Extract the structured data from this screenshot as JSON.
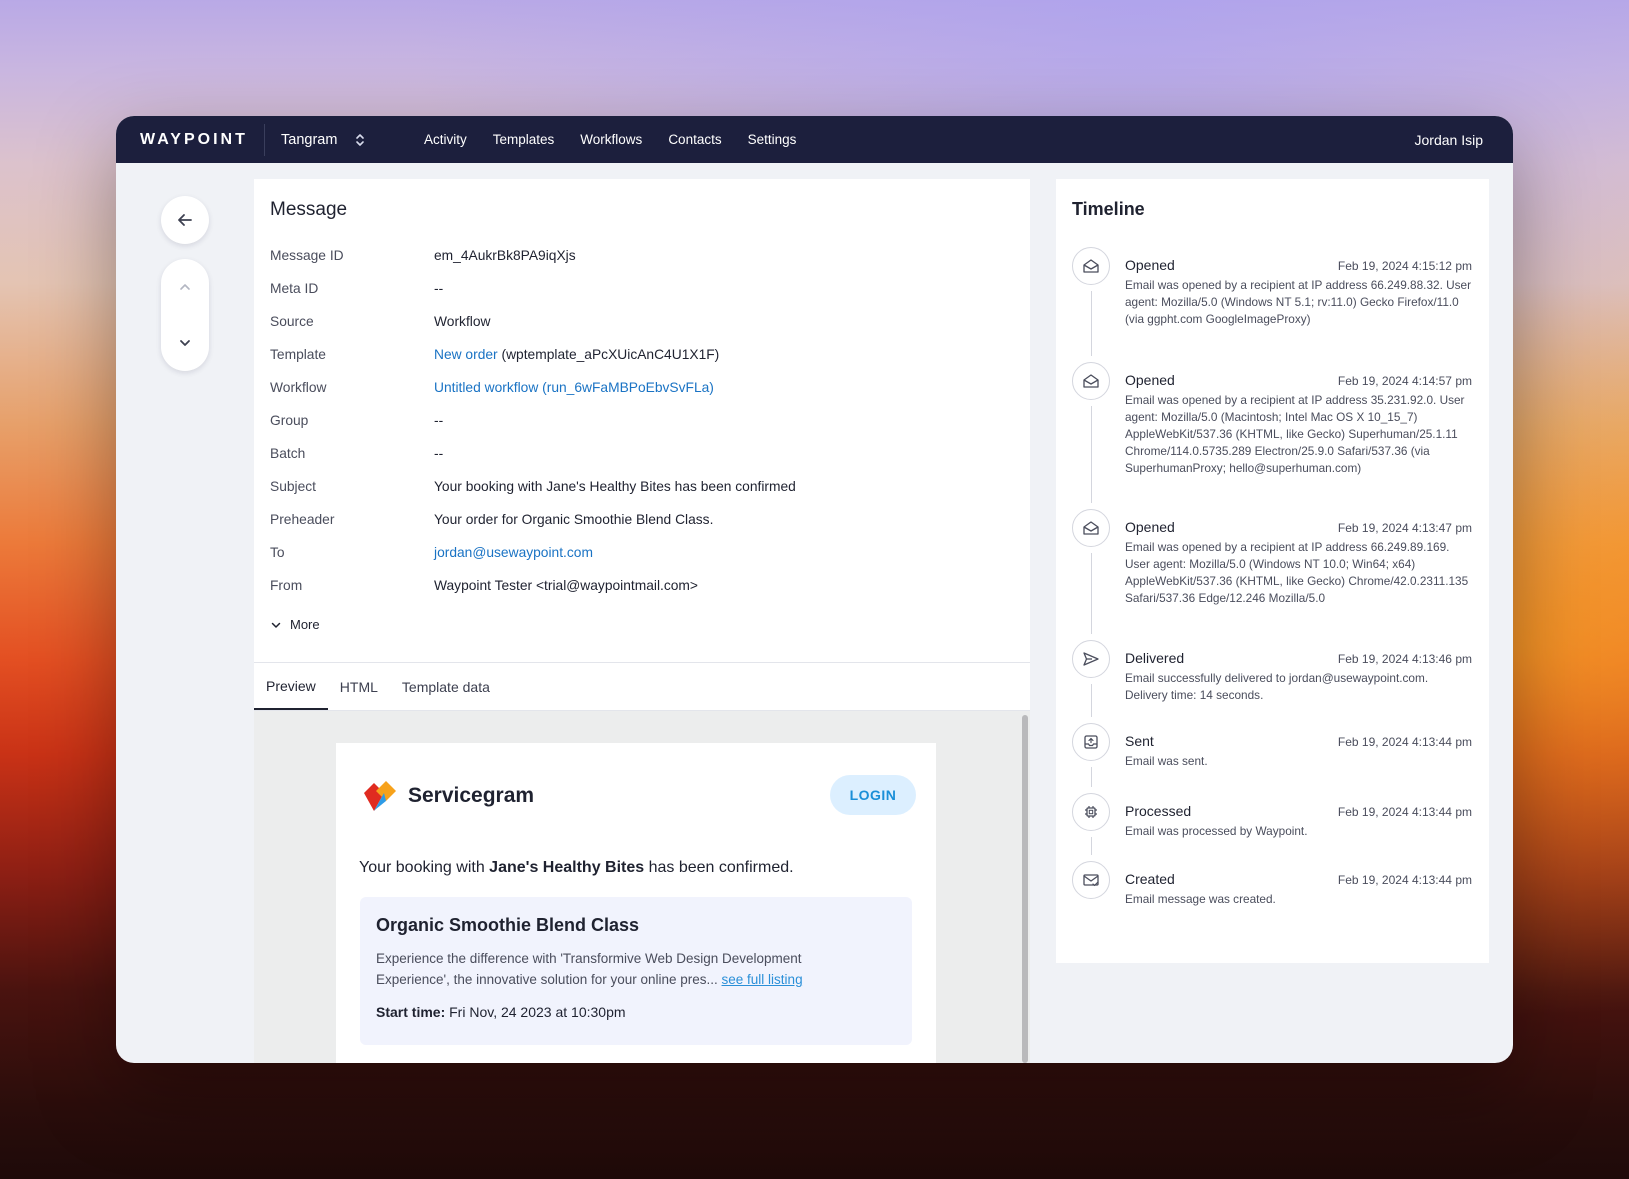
{
  "topbar": {
    "brand": "WAYPOINT",
    "workspace": "Tangram",
    "nav": [
      "Activity",
      "Templates",
      "Workflows",
      "Contacts",
      "Settings"
    ],
    "user": "Jordan Isip"
  },
  "message": {
    "title": "Message",
    "fields": {
      "message_id": {
        "label": "Message ID",
        "value": "em_4AukrBk8PA9iqXjs"
      },
      "meta_id": {
        "label": "Meta ID",
        "value": "--"
      },
      "source": {
        "label": "Source",
        "value": "Workflow"
      },
      "template": {
        "label": "Template",
        "link": "New order",
        "rest": " (wptemplate_aPcXUicAnC4U1X1F)"
      },
      "workflow": {
        "label": "Workflow",
        "link": "Untitled workflow",
        "open": " (",
        "run_link": "run_6wFaMBPoEbvSvFLa",
        "close": ")"
      },
      "group": {
        "label": "Group",
        "value": "--"
      },
      "batch": {
        "label": "Batch",
        "value": "--"
      },
      "subject": {
        "label": "Subject",
        "value": "Your booking with Jane's Healthy Bites has been confirmed"
      },
      "preheader": {
        "label": "Preheader",
        "value": "Your order for Organic Smoothie Blend Class."
      },
      "to": {
        "label": "To",
        "value": "jordan@usewaypoint.com"
      },
      "from": {
        "label": "From",
        "value": "Waypoint Tester <trial@waypointmail.com>"
      }
    },
    "more_label": "More",
    "tabs": [
      "Preview",
      "HTML",
      "Template data"
    ],
    "active_tab": "Preview"
  },
  "email_preview": {
    "logo_text": "Servicegram",
    "login_label": "LOGIN",
    "headline_pre": "Your booking with ",
    "headline_bold": "Jane's Healthy Bites",
    "headline_post": " has been confirmed.",
    "card_title": "Organic Smoothie Blend Class",
    "card_desc": "Experience the difference with 'Transformive Web Design Development Experience', the innovative solution for your online pres... ",
    "card_link": "see full listing",
    "start_label": "Start time:",
    "start_value": " Fri Nov, 24 2023 at 10:30pm",
    "colors": {
      "login_bg": "#dcefff",
      "login_text": "#1a8fd8",
      "card_bg": "#f1f3fd",
      "logo_red": "#e02b20",
      "logo_orange": "#f7a21b",
      "logo_blue": "#2e9be6"
    }
  },
  "timeline": {
    "title": "Timeline",
    "events": [
      {
        "icon": "envelope-open-icon",
        "event": "Opened",
        "time": "Feb 19, 2024 4:15:12 pm",
        "desc": "Email was opened by a recipient at IP address 66.249.88.32. User agent: Mozilla/5.0 (Windows NT 5.1; rv:11.0) Gecko Firefox/11.0 (via ggpht.com GoogleImageProxy)"
      },
      {
        "icon": "envelope-open-icon",
        "event": "Opened",
        "time": "Feb 19, 2024 4:14:57 pm",
        "desc": "Email was opened by a recipient at IP address 35.231.92.0. User agent: Mozilla/5.0 (Macintosh; Intel Mac OS X 10_15_7) AppleWebKit/537.36 (KHTML, like Gecko) Superhuman/25.1.11 Chrome/114.0.5735.289 Electron/25.9.0 Safari/537.36 (via SuperhumanProxy; hello@superhuman.com)"
      },
      {
        "icon": "envelope-open-icon",
        "event": "Opened",
        "time": "Feb 19, 2024 4:13:47 pm",
        "desc": "Email was opened by a recipient at IP address 66.249.89.169. User agent: Mozilla/5.0 (Windows NT 10.0; Win64; x64) AppleWebKit/537.36 (KHTML, like Gecko) Chrome/42.0.2311.135 Safari/537.36 Edge/12.246 Mozilla/5.0"
      },
      {
        "icon": "paper-plane-icon",
        "event": "Delivered",
        "time": "Feb 19, 2024 4:13:46 pm",
        "desc": "Email successfully delivered to jordan@usewaypoint.com. Delivery time: 14 seconds."
      },
      {
        "icon": "outbox-icon",
        "event": "Sent",
        "time": "Feb 19, 2024 4:13:44 pm",
        "desc": "Email was sent."
      },
      {
        "icon": "chip-icon",
        "event": "Processed",
        "time": "Feb 19, 2024 4:13:44 pm",
        "desc": "Email was processed by Waypoint."
      },
      {
        "icon": "envelope-check-icon",
        "event": "Created",
        "time": "Feb 19, 2024 4:13:44 pm",
        "desc": "Email message was created."
      }
    ]
  },
  "colors": {
    "topbar": "#1c1f3d",
    "link": "#1a73c4",
    "page_bg": "#f0f2f6"
  }
}
